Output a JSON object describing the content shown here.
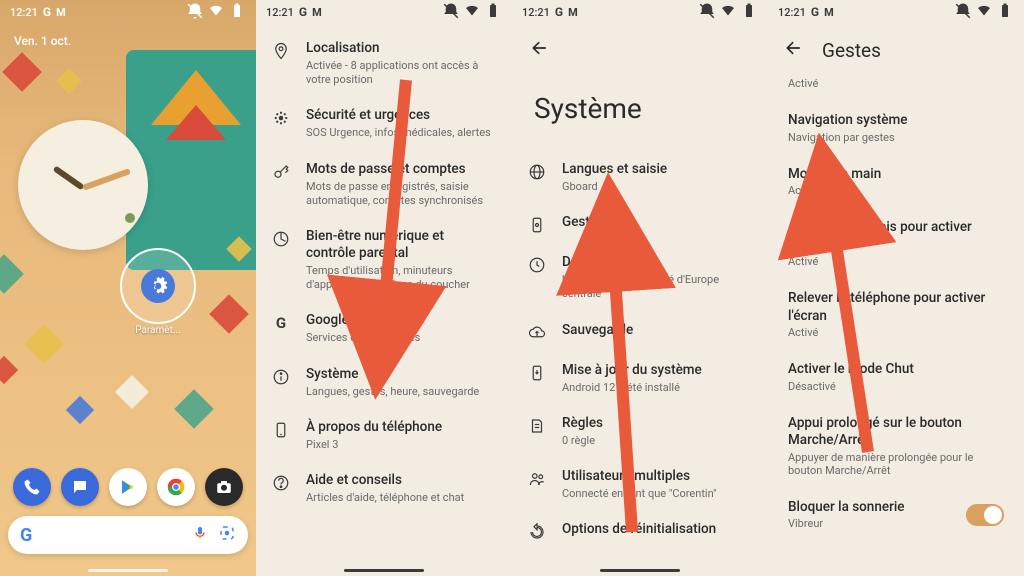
{
  "status": {
    "time": "12:21",
    "brand_g": "G",
    "brand_m": "M"
  },
  "home": {
    "date": "Ven. 1 oct.",
    "settings_label": "Paramèt...",
    "search_logo": "G"
  },
  "settings_main": {
    "items": [
      {
        "title": "Localisation",
        "sub": "Activée - 8 applications ont accès à votre position"
      },
      {
        "title": "Sécurité et urgences",
        "sub": "SOS Urgence, infos médicales, alertes"
      },
      {
        "title": "Mots de passe et comptes",
        "sub": "Mots de passe enregistrés, saisie automatique, comptes synchronisés"
      },
      {
        "title": "Bien-être numérique et contrôle parental",
        "sub": "Temps d'utilisation, minuteurs d'application, routines du coucher"
      },
      {
        "title": "Google",
        "sub": "Services et préférences"
      },
      {
        "title": "Système",
        "sub": "Langues, gestes, heure, sauvegarde"
      },
      {
        "title": "À propos du téléphone",
        "sub": "Pixel 3"
      },
      {
        "title": "Aide et conseils",
        "sub": "Articles d'aide, téléphone et chat"
      }
    ]
  },
  "system": {
    "page_title": "Système",
    "items": [
      {
        "title": "Langues et saisie",
        "sub": "Gboard"
      },
      {
        "title": "Gestes",
        "sub": ""
      },
      {
        "title": "Date et heure",
        "sub": "UTC+02:00 Heure d'été d'Europe centrale"
      },
      {
        "title": "Sauvegarde",
        "sub": ""
      },
      {
        "title": "Mise à jour du système",
        "sub": "Android 12 a été installé"
      },
      {
        "title": "Règles",
        "sub": "0 règle"
      },
      {
        "title": "Utilisateurs multiples",
        "sub": "Connecté en tant que \"Corentin\""
      },
      {
        "title": "Options de réinitialisation",
        "sub": ""
      }
    ]
  },
  "gestes": {
    "page_title": "Gestes",
    "prev_sub": "Activé",
    "items": [
      {
        "title": "Navigation système",
        "sub": "Navigation par gestes"
      },
      {
        "title": "Mode une main",
        "sub": "Activé"
      },
      {
        "title": "Appuyer deux fois pour activer l'écran",
        "sub": "Activé"
      },
      {
        "title": "Relever le téléphone pour activer l'écran",
        "sub": "Activé"
      },
      {
        "title": "Activer le mode Chut",
        "sub": "Désactivé"
      },
      {
        "title": "Appui prolongé sur le bouton Marche/Arrêt",
        "sub": "Appuyer de manière prolongée pour le bouton Marche/Arrêt"
      },
      {
        "title": "Bloquer la sonnerie",
        "sub": "Vibreur",
        "toggle": true
      }
    ]
  }
}
